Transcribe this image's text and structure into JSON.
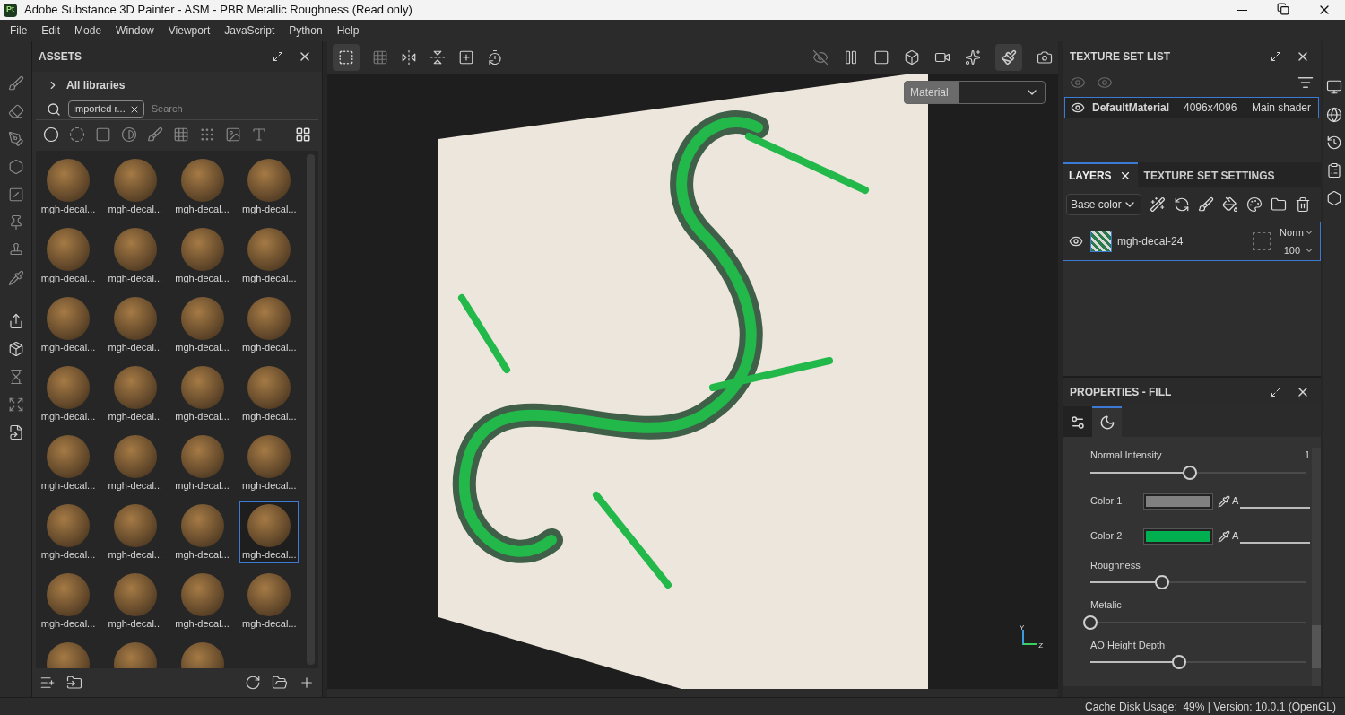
{
  "window": {
    "title": "Adobe Substance 3D Painter - ASM - PBR Metallic Roughness (Read only)",
    "app_badge": "Pt"
  },
  "menu": [
    "File",
    "Edit",
    "Mode",
    "Window",
    "Viewport",
    "JavaScript",
    "Python",
    "Help"
  ],
  "assets": {
    "title": "ASSETS",
    "library": "All libraries",
    "filter_chip": "Imported r...",
    "search": {
      "placeholder": "Search"
    },
    "items": [
      {
        "kind": "full",
        "label": "mgh-decal...",
        "selected": false
      },
      {
        "kind": "full",
        "label": "mgh-decal...",
        "selected": false
      },
      {
        "kind": "full",
        "label": "mgh-decal...",
        "selected": false
      },
      {
        "kind": "full",
        "label": "mgh-decal...",
        "selected": false
      },
      {
        "kind": "full",
        "label": "mgh-decal...",
        "selected": false
      },
      {
        "kind": "full",
        "label": "mgh-decal...",
        "selected": false
      },
      {
        "kind": "full",
        "label": "mgh-decal...",
        "selected": false
      },
      {
        "kind": "full",
        "label": "mgh-decal...",
        "selected": false
      },
      {
        "kind": "full",
        "label": "mgh-decal...",
        "selected": false
      },
      {
        "kind": "full",
        "label": "mgh-decal...",
        "selected": false
      },
      {
        "kind": "full",
        "label": "mgh-decal...",
        "selected": false
      },
      {
        "kind": "full",
        "label": "mgh-decal...",
        "selected": false
      },
      {
        "kind": "full",
        "label": "mgh-decal...",
        "selected": false
      },
      {
        "kind": "full",
        "label": "mgh-decal...",
        "selected": false
      },
      {
        "kind": "full",
        "label": "mgh-decal...",
        "selected": false
      },
      {
        "kind": "full",
        "label": "mgh-decal...",
        "selected": false
      },
      {
        "kind": "full",
        "label": "mgh-decal...",
        "selected": false
      },
      {
        "kind": "full",
        "label": "mgh-decal...",
        "selected": false
      },
      {
        "kind": "full",
        "label": "mgh-decal...",
        "selected": false
      },
      {
        "kind": "full",
        "label": "mgh-decal...",
        "selected": false
      },
      {
        "kind": "full",
        "label": "mgh-decal...",
        "selected": false
      },
      {
        "kind": "full",
        "label": "mgh-decal...",
        "selected": false
      },
      {
        "kind": "full",
        "label": "mgh-decal...",
        "selected": false
      },
      {
        "kind": "full",
        "label": "mgh-decal...",
        "selected": true
      },
      {
        "kind": "full",
        "label": "mgh-decal...",
        "selected": false
      },
      {
        "kind": "full",
        "label": "mgh-decal...",
        "selected": false
      },
      {
        "kind": "full",
        "label": "mgh-decal...",
        "selected": false
      },
      {
        "kind": "full",
        "label": "mgh-decal...",
        "selected": false
      },
      {
        "kind": "cut",
        "selected": false
      },
      {
        "kind": "cut",
        "selected": false
      },
      {
        "kind": "cut",
        "selected": false
      }
    ]
  },
  "viewport": {
    "channel_select": "Material",
    "axis_labels": [
      "Y",
      "Z"
    ]
  },
  "texture_set_list": {
    "title": "TEXTURE SET LIST",
    "rows": [
      {
        "name": "DefaultMaterial",
        "resolution": "4096x4096",
        "shader": "Main shader",
        "selected": true
      }
    ]
  },
  "layers": {
    "tabs": [
      {
        "label": "LAYERS",
        "selected": true
      },
      {
        "label": "TEXTURE SET SETTINGS",
        "selected": false
      }
    ],
    "channel": "Base color",
    "items": [
      {
        "name": "mgh-decal-24",
        "blend": "Norm",
        "opacity": "100",
        "selected": true
      }
    ]
  },
  "properties": {
    "title": "PROPERTIES - FILL",
    "tabs": [
      {
        "kind": "settings",
        "selected": false
      },
      {
        "kind": "material",
        "selected": true
      }
    ],
    "params": [
      {
        "kind": "slider",
        "label": "Normal Intensity",
        "value": "1",
        "level": 0.46
      },
      {
        "kind": "color",
        "label": "Color 1",
        "color": "#808080",
        "alpha_label": "A"
      },
      {
        "kind": "color",
        "label": "Color 2",
        "color": "#00b050",
        "alpha_label": "A"
      },
      {
        "kind": "slider",
        "label": "Roughness",
        "level": 0.33
      },
      {
        "kind": "slider",
        "label": "Metalic",
        "level": 0
      },
      {
        "kind": "slider",
        "label": "AO Height Depth",
        "level": 0.41
      }
    ]
  },
  "status_bar": "Cache Disk Usage:  49% | Version: 10.0.1 (OpenGL)"
}
